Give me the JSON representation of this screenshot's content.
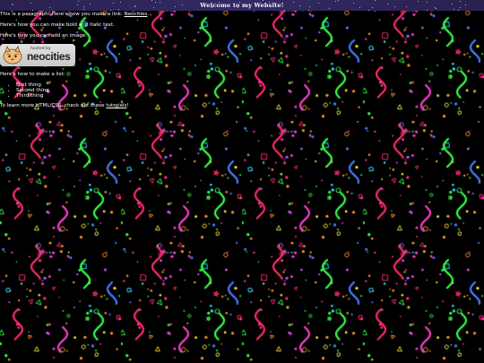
{
  "header": {
    "title": "Welcome to my Website!"
  },
  "content": {
    "para1": {
      "before": "This is a paragraph! Here's how you make a link: ",
      "link": "Neocities",
      "after": "."
    },
    "para2": "Here's how you can make bold and italic text.",
    "para3": "Here's how you can add an image:",
    "badge": {
      "hosted_text": "hosted by",
      "brand": "neocities"
    },
    "list_intro": "Here's how to make a list:",
    "list_items": [
      "First thing",
      "Second thing",
      "Third thing"
    ],
    "para_css": {
      "before": "To learn more HTML/CSS, check out these ",
      "link": "tutorials",
      "after": "!"
    }
  },
  "colors": {
    "background": "#000000",
    "header_bg": "#2d245a",
    "confetti": [
      "#ff2d6b",
      "#39ff4a",
      "#4a7dff",
      "#ff9a2e",
      "#ff3dd1",
      "#b45cff",
      "#2ee6ff",
      "#ffe63d"
    ]
  },
  "icons": {
    "badge_mascot": "neocities-cat-icon"
  }
}
